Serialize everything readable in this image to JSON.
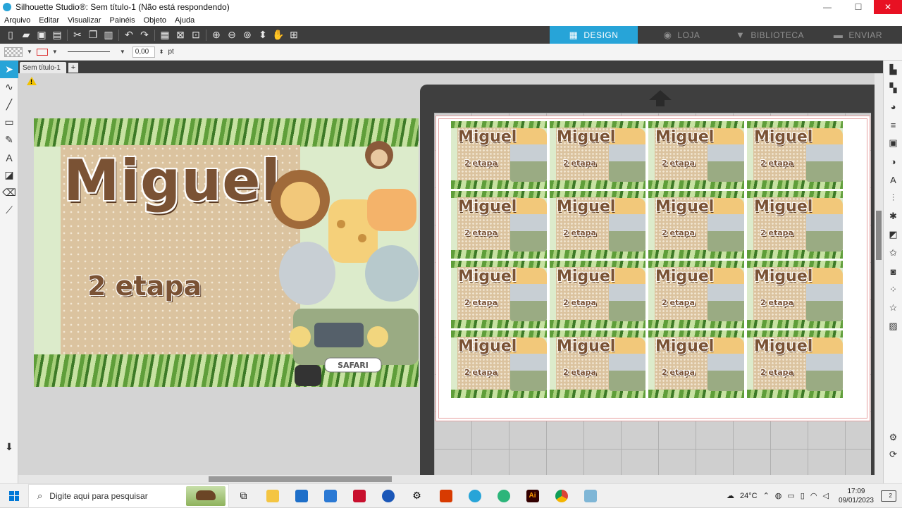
{
  "window": {
    "title": "Silhouette Studio®: Sem título-1 (Não está respondendo)"
  },
  "menu": [
    "Arquivo",
    "Editar",
    "Visualizar",
    "Painéis",
    "Objeto",
    "Ajuda"
  ],
  "mode_tabs": [
    {
      "label": "DESIGN",
      "icon": "grid-icon",
      "active": true
    },
    {
      "label": "LOJA",
      "icon": "store-icon",
      "active": false
    },
    {
      "label": "BIBLIOTECA",
      "icon": "library-icon",
      "active": false
    },
    {
      "label": "ENVIAR",
      "icon": "send-icon",
      "active": false
    }
  ],
  "props": {
    "line_width": "0,00",
    "unit": "pt"
  },
  "doc_tab": "Sem título-1",
  "design": {
    "name": "Miguel",
    "subtitle": "2 etapa",
    "vehicle_label": "SAFARI"
  },
  "taskbar": {
    "search_placeholder": "Digite aqui para pesquisar",
    "weather": "24°C",
    "time": "17:09",
    "date": "09/01/2023",
    "notifications": "2"
  },
  "colors": {
    "accent": "#27a4d8",
    "toolbar": "#3d3d3d",
    "close": "#e81123"
  }
}
